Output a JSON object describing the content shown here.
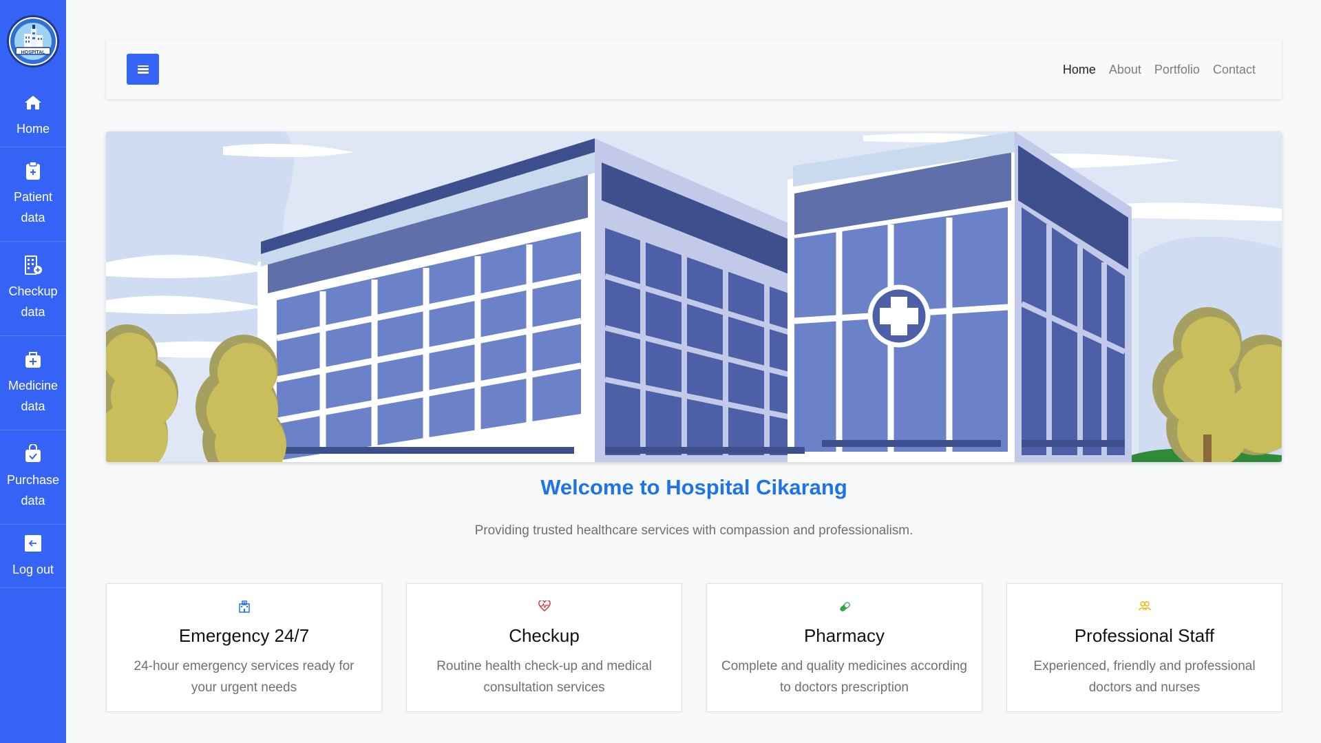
{
  "sidebar": {
    "logo_text": "HOSPITAL",
    "items": [
      {
        "label": "Home",
        "icon": "home-icon"
      },
      {
        "label": "Patient data",
        "icon": "clipboard-plus-icon"
      },
      {
        "label": "Checkup data",
        "icon": "building-add-icon"
      },
      {
        "label": "Medicine data",
        "icon": "medical-bag-icon"
      },
      {
        "label": "Purchase data",
        "icon": "shopping-bag-check-icon"
      },
      {
        "label": "Log out",
        "icon": "arrow-left-icon"
      }
    ]
  },
  "topbar": {
    "menu_icon": "hamburger-icon",
    "links": [
      {
        "label": "Home",
        "active": true
      },
      {
        "label": "About",
        "active": false
      },
      {
        "label": "Portfolio",
        "active": false
      },
      {
        "label": "Contact",
        "active": false
      }
    ]
  },
  "hero": {
    "title": "Welcome to Hospital Cikarang",
    "subtitle": "Providing trusted healthcare services with compassion and professionalism."
  },
  "features": [
    {
      "title": "Emergency 24/7",
      "desc": "24-hour emergency services ready for your urgent needs",
      "icon": "hospital-icon",
      "color": "#1f73e8"
    },
    {
      "title": "Checkup",
      "desc": "Routine health check-up and medical consultation services",
      "icon": "heart-pulse-icon",
      "color": "#dc3545"
    },
    {
      "title": "Pharmacy",
      "desc": "Complete and quality medicines according to doctors prescription",
      "icon": "capsule-icon",
      "color": "#28a745"
    },
    {
      "title": "Professional Staff",
      "desc": "Experienced, friendly and professional doctors and nurses",
      "icon": "people-icon",
      "color": "#f0b400"
    }
  ],
  "colors": {
    "sidebar": "#3563f5",
    "accent": "#1f73e8"
  }
}
